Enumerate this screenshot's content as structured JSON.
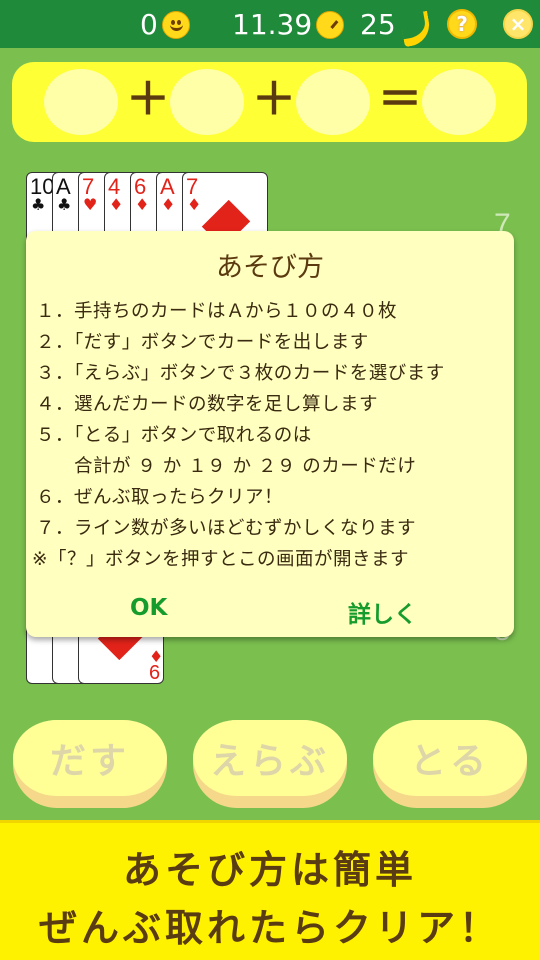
{
  "status": {
    "score": "0",
    "score_icon": "smiley-icon",
    "time": "11.39",
    "time_icon": "clock-icon",
    "bananas": "25",
    "bananas_icon": "banana-icon",
    "help_label": "?",
    "close_label": "×"
  },
  "equation": {
    "plus_1": "＋",
    "plus_2": "＋",
    "equals": "＝"
  },
  "hand_cards": [
    {
      "rank": "10",
      "suit": "♣",
      "color": "black"
    },
    {
      "rank": "A",
      "suit": "♣",
      "color": "black"
    },
    {
      "rank": "7",
      "suit": "♥",
      "color": "red"
    },
    {
      "rank": "4",
      "suit": "♦",
      "color": "red"
    },
    {
      "rank": "6",
      "suit": "♦",
      "color": "red"
    },
    {
      "rank": "A",
      "suit": "♦",
      "color": "red"
    },
    {
      "rank": "7",
      "suit": "♦",
      "color": "red"
    }
  ],
  "bottom_card": {
    "rank": "6",
    "suit": "♦"
  },
  "line_counts": {
    "top": "7",
    "bottom": "5"
  },
  "dialog": {
    "title": "あそび方",
    "rules": [
      "１．手持ちのカードはＡから１０の４０枚",
      "２．「だす」ボタンでカードを出します",
      "３．「えらぶ」ボタンで３枚のカードを選びます",
      "４．選んだカードの数字を足し算します",
      "５．「とる」ボタンで取れるのは",
      "　　合計が ９ か １９ か ２９ のカードだけ",
      "６．ぜんぶ取ったらクリア！",
      "７．ライン数が多いほどむずかしくなります",
      "※「？」ボタンを押すとこの画面が開きます"
    ],
    "ok_label": "OK",
    "details_label": "詳しく"
  },
  "actions": {
    "deal_label": "だす",
    "select_label": "えらぶ",
    "take_label": "とる"
  },
  "banner": {
    "line1": "あそび方は簡単",
    "line2": "ぜんぶ取れたらクリア！"
  },
  "colors": {
    "background": "#7bc04f",
    "topbar": "#1f8a3a",
    "panel": "#ffff36",
    "dialog": "#ffffbf",
    "button_text": "#159c2c",
    "banner": "#fff200"
  }
}
